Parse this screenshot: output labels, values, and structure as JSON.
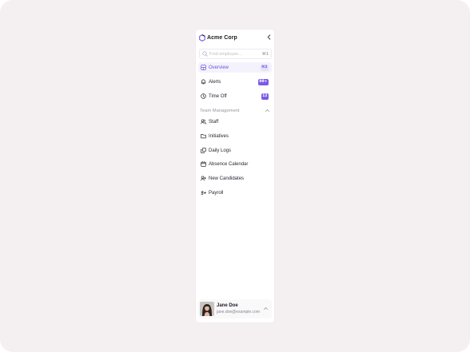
{
  "brand": {
    "name": "Acme Corp",
    "logo": "hexagon-logo-icon"
  },
  "colors": {
    "accent": "#7b5be6",
    "accent_text": "#6a55d9",
    "background": "#f4f0f2",
    "sidebar": "#ffffff"
  },
  "search": {
    "placeholder": "Find employee...",
    "value": "",
    "shortcut": "⌘1",
    "icon": "search-icon"
  },
  "nav": [
    {
      "label": "Overview",
      "icon": "grid-icon",
      "badge": "⌘2",
      "badge_style": "light",
      "active": true
    },
    {
      "label": "Alerts",
      "icon": "bell-icon",
      "badge": "99+",
      "badge_style": "solid",
      "active": false
    },
    {
      "label": "Time Off",
      "icon": "clock-icon",
      "badge": "12",
      "badge_style": "solid",
      "active": false
    }
  ],
  "section": {
    "label": "Team Management",
    "expanded": true,
    "items": [
      {
        "label": "Staff",
        "icon": "users-icon"
      },
      {
        "label": "Initiatives",
        "icon": "folder-icon"
      },
      {
        "label": "Daily Logs",
        "icon": "copy-icon"
      },
      {
        "label": "Absence Calendar",
        "icon": "calendar-icon"
      },
      {
        "label": "New Candidates",
        "icon": "user-plus-icon"
      },
      {
        "label": "Payroll",
        "icon": "dollar-icon"
      }
    ]
  },
  "user": {
    "name": "Jane Doe",
    "email": "jane.doe@example.com"
  }
}
